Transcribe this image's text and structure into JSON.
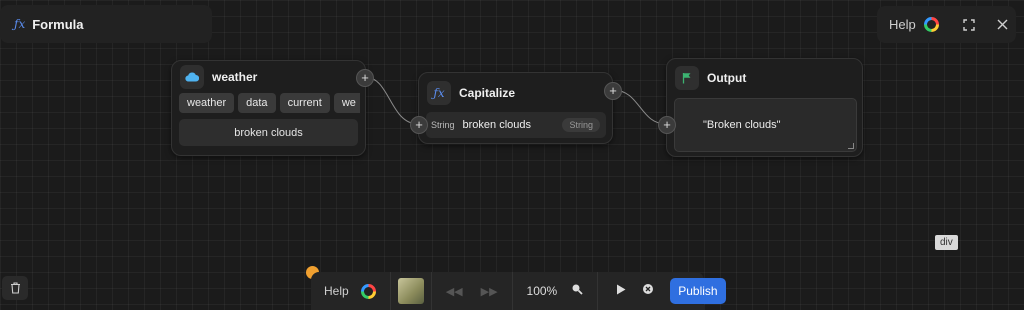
{
  "header": {
    "title": "Formula",
    "icon": "fx-icon"
  },
  "top_right": {
    "help_label": "Help",
    "icons": [
      "help-ring-icon",
      "expand-icon",
      "close-icon"
    ]
  },
  "nodes": {
    "weather": {
      "title": "weather",
      "icon": "cloud-icon",
      "path_chips": [
        "weather",
        "data",
        "current",
        "we"
      ],
      "value": "broken clouds"
    },
    "capitalize": {
      "title": "Capitalize",
      "icon": "fx-icon",
      "input_type": "String",
      "input_value": "broken clouds",
      "output_type": "String"
    },
    "output": {
      "title": "Output",
      "icon": "flag-icon",
      "value": "\"Broken clouds\""
    }
  },
  "tooltip": "div",
  "toolbar": {
    "help_label": "Help",
    "zoom": "100%",
    "publish_label": "Publish"
  },
  "colors": {
    "accent": "#2f6fe0",
    "fx": "#5b8def",
    "cloud": "#4fb3f0",
    "flag": "#3cb371",
    "notification": "#f0a030"
  }
}
